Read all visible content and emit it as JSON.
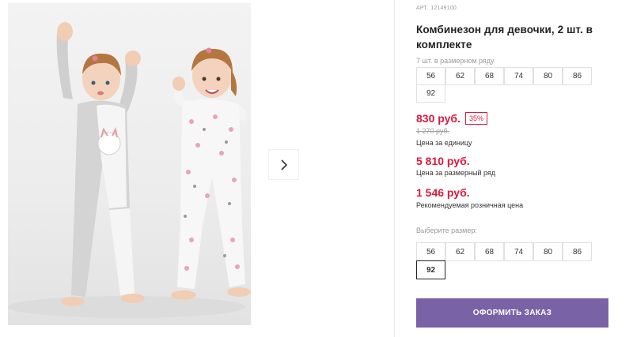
{
  "product": {
    "sku_label": "АРТ.",
    "sku": "12149100",
    "title": "Комбинезон для девочки, 2 шт. в комплекте"
  },
  "size_row": {
    "label": "7 шт. в размерном ряду",
    "sizes": [
      "56",
      "62",
      "68",
      "74",
      "80",
      "86",
      "92"
    ]
  },
  "prices": {
    "current": "830 руб.",
    "discount_badge": "35%",
    "old": "1 270 руб.",
    "unit_label": "Цена за единицу",
    "row_price": "5 810 руб.",
    "row_price_label": "Цена за размерный ряд",
    "rrp": "1 546 руб.",
    "rrp_label": "Рекомендуемая розничная цена"
  },
  "size_select": {
    "label": "Выберите размер:",
    "sizes": [
      "56",
      "62",
      "68",
      "74",
      "80",
      "86",
      "92"
    ],
    "selected": "92"
  },
  "order_button": {
    "label": "ОФОРМИТЬ ЗАКАЗ"
  },
  "gallery": {
    "next_icon": "chevron-right-icon"
  },
  "colors": {
    "accent": "#7a62a6",
    "price": "#d81b3d"
  }
}
